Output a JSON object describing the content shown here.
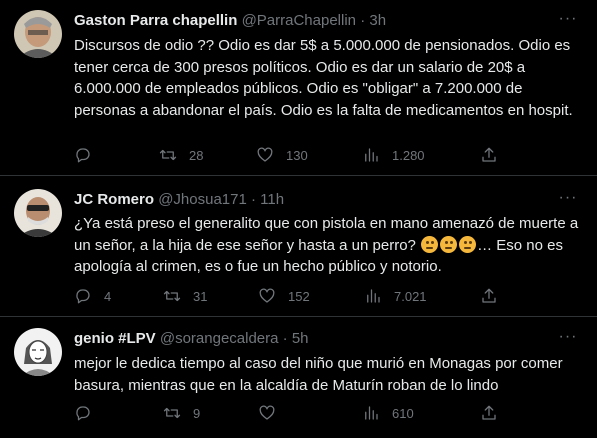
{
  "tweets": [
    {
      "name": "Gaston Parra chapellin",
      "handle": "@ParraChapellin",
      "time": "3h",
      "text": "Discursos de odio ?? Odio es dar 5$ a 5.000.000 de pensionados. Odio es tener cerca de 300 presos políticos. Odio es dar un salario de 20$ a 6.000.000 de empleados públicos. Odio es \"obligar\" a 7.200.000 de personas a abandonar el país. Odio es la falta de medicamentos en hospit.",
      "replies": "",
      "retweets": "28",
      "likes": "130",
      "views": "1.280"
    },
    {
      "name": "JC Romero",
      "handle": "@Jhosua171",
      "time": "11h",
      "text_a": "¿Ya está preso el generalito que con pistola en mano amenazó de muerte a un señor, a la hija de ese señor y hasta a un perro?",
      "text_b": "… Eso no es apología al crimen, es o fue un hecho público y notorio.",
      "emojis": [
        "thinking-face",
        "thinking-face",
        "thinking-face"
      ],
      "replies": "4",
      "retweets": "31",
      "likes": "152",
      "views": "7.021"
    },
    {
      "name": "genio #LPV",
      "handle": "@sorangecaldera",
      "time": "5h",
      "text": "mejor le dedica tiempo al caso del niño que murió en Monagas por comer basura, mientras que en la alcaldía de Maturín roban de lo lindo",
      "replies": "",
      "retweets": "9",
      "likes": "",
      "views": "610"
    }
  ],
  "separator": "·",
  "more_label": "···",
  "colors": {
    "background": "#000000",
    "text": "#e7e9ea",
    "muted": "#71767b",
    "border": "#2f3336"
  }
}
